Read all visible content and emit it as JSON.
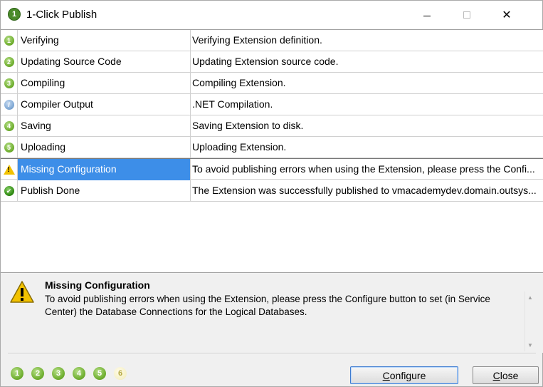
{
  "window": {
    "title": "1-Click Publish",
    "app_icon_label": "1",
    "close_glyph": "✕"
  },
  "rows": [
    {
      "icon": "1",
      "icon_type": "step",
      "step": "Verifying",
      "message": "Verifying Extension definition."
    },
    {
      "icon": "2",
      "icon_type": "step",
      "step": "Updating Source Code",
      "message": "Updating Extension source code."
    },
    {
      "icon": "3",
      "icon_type": "step",
      "step": "Compiling",
      "message": "Compiling Extension."
    },
    {
      "icon": "i",
      "icon_type": "info",
      "step": "Compiler Output",
      "message": ".NET Compilation."
    },
    {
      "icon": "4",
      "icon_type": "step",
      "step": "Saving",
      "message": "Saving Extension to disk."
    },
    {
      "icon": "5",
      "icon_type": "step",
      "step": "Uploading",
      "message": "Uploading Extension."
    },
    {
      "icon": "!",
      "icon_type": "warning",
      "step": "Missing Configuration",
      "message": "To avoid publishing errors when using the Extension, please press the Confi..."
    },
    {
      "icon": "✔",
      "icon_type": "done",
      "step": "Publish Done",
      "message": "The Extension was successfully published to vmacademydev.domain.outsys..."
    }
  ],
  "detail": {
    "title": "Missing Configuration",
    "text": "To avoid publishing errors when using the Extension, please press the Configure button to set (in Service Center) the Database Connections for the Logical Databases."
  },
  "steps": [
    "1",
    "2",
    "3",
    "4",
    "5",
    "6"
  ],
  "buttons": {
    "configure_first": "C",
    "configure_rest": "onfigure",
    "close_first": "C",
    "close_rest": "lose"
  },
  "colors": {
    "selection": "#3d8ee8",
    "step_green": "#6fae2f",
    "warning_yellow": "#f2c200"
  }
}
